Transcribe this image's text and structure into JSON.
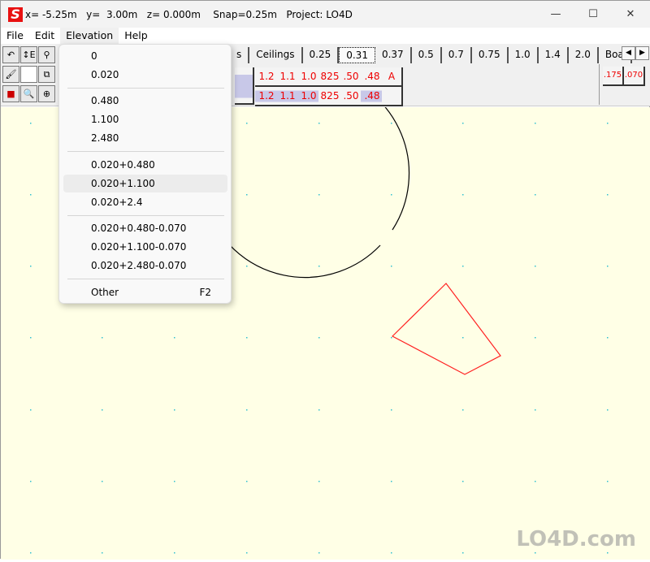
{
  "title": {
    "logo": "S",
    "text": "x= -5.25m   y=  3.00m   z= 0.000m    Snap=0.25m   Project: LO4D"
  },
  "window_controls": {
    "minimize": "—",
    "maximize": "☐",
    "close": "✕"
  },
  "menubar": [
    "File",
    "Edit",
    "Elevation",
    "Help"
  ],
  "tabs": [
    "s",
    "Ceilings",
    "0.25",
    "0.31",
    "0.37",
    "0.5",
    "0.7",
    "0.75",
    "1.0",
    "1.4",
    "2.0",
    "Boa"
  ],
  "selected_tab": "0.31",
  "wall_buttons_top": [
    "1.2",
    "1.1",
    "1.0",
    "825",
    ".50",
    ".48",
    "A"
  ],
  "wall_buttons_bottom": [
    "1.2",
    "1.1",
    "1.0",
    "825",
    ".50",
    ".48",
    ""
  ],
  "right_buttons": [
    ".175",
    ".070"
  ],
  "elevation_menu": {
    "groups": [
      [
        "0",
        "0.020"
      ],
      [
        "0.480",
        "1.100",
        "2.480"
      ],
      [
        "0.020+0.480",
        "0.020+1.100",
        "0.020+2.4"
      ],
      [
        "0.020+0.480-0.070",
        "0.020+1.100-0.070",
        "0.020+2.480-0.070"
      ]
    ],
    "other": {
      "label": "Other",
      "shortcut": "F2"
    },
    "highlighted": "0.020+1.100"
  },
  "colors": {
    "canvas": "#ffffe6",
    "grid_dot": "#30c0d0",
    "circle": "#000000",
    "polygon": "#ff2020"
  },
  "watermark": "LO4D.com"
}
